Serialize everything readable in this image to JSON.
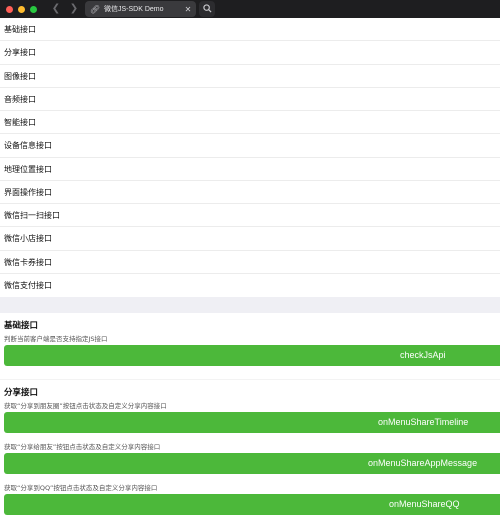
{
  "browser": {
    "tab_title": "微信JS-SDK Demo",
    "icons": {
      "back": "chevron-left-icon",
      "forward": "chevron-right-icon",
      "reload": "reload-icon",
      "tab": "link-icon",
      "close": "close-icon",
      "search": "search-icon"
    }
  },
  "nav": {
    "items": [
      {
        "label": "基础接口"
      },
      {
        "label": "分享接口"
      },
      {
        "label": "图像接口"
      },
      {
        "label": "音频接口"
      },
      {
        "label": "智能接口"
      },
      {
        "label": "设备信息接口"
      },
      {
        "label": "地理位置接口"
      },
      {
        "label": "界面操作接口"
      },
      {
        "label": "微信扫一扫接口"
      },
      {
        "label": "微信小店接口"
      },
      {
        "label": "微信卡券接口"
      },
      {
        "label": "微信支付接口"
      }
    ]
  },
  "sections": {
    "basic": {
      "title": "基础接口",
      "desc": "判断当前客户端是否支持指定JS接口",
      "button": "checkJsApi"
    },
    "share": {
      "title": "分享接口",
      "items": [
        {
          "desc": "获取“分享到朋友圈”按钮点击状态及自定义分享内容接口",
          "button": "onMenuShareTimeline"
        },
        {
          "desc": "获取“分享给朋友”按钮点击状态及自定义分享内容接口",
          "button": "onMenuShareAppMessage"
        },
        {
          "desc": "获取“分享到QQ”按钮点击状态及自定义分享内容接口",
          "button": "onMenuShareQQ"
        }
      ]
    }
  },
  "colors": {
    "button": "#4cb83a",
    "chrome": "#1e1e20",
    "band": "#efeff4"
  }
}
